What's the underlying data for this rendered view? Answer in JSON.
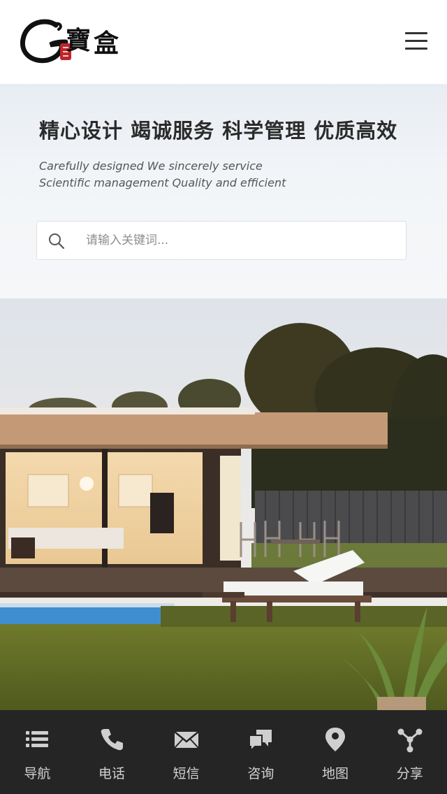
{
  "header": {
    "logo_alt": "G 寶盒",
    "menu_icon": "hamburger-menu-icon"
  },
  "hero": {
    "title": "精心设计  竭诚服务  科学管理   优质高效",
    "subtitle_line1": "Carefully designed    We sincerely service",
    "subtitle_line2": "Scientific management    Quality and efficient",
    "search_placeholder": "请输入关键词...",
    "search_value": ""
  },
  "bottom_nav": {
    "items": [
      {
        "label": "导航",
        "icon": "list-icon"
      },
      {
        "label": "电话",
        "icon": "phone-icon"
      },
      {
        "label": "短信",
        "icon": "envelope-icon"
      },
      {
        "label": "咨询",
        "icon": "chat-icon"
      },
      {
        "label": "地图",
        "icon": "map-pin-icon"
      },
      {
        "label": "分享",
        "icon": "share-icon"
      }
    ]
  },
  "colors": {
    "nav_bg": "#252525",
    "nav_text": "#d2d2d2",
    "icon": "#cfcfcf",
    "title": "#2b2b2b"
  }
}
